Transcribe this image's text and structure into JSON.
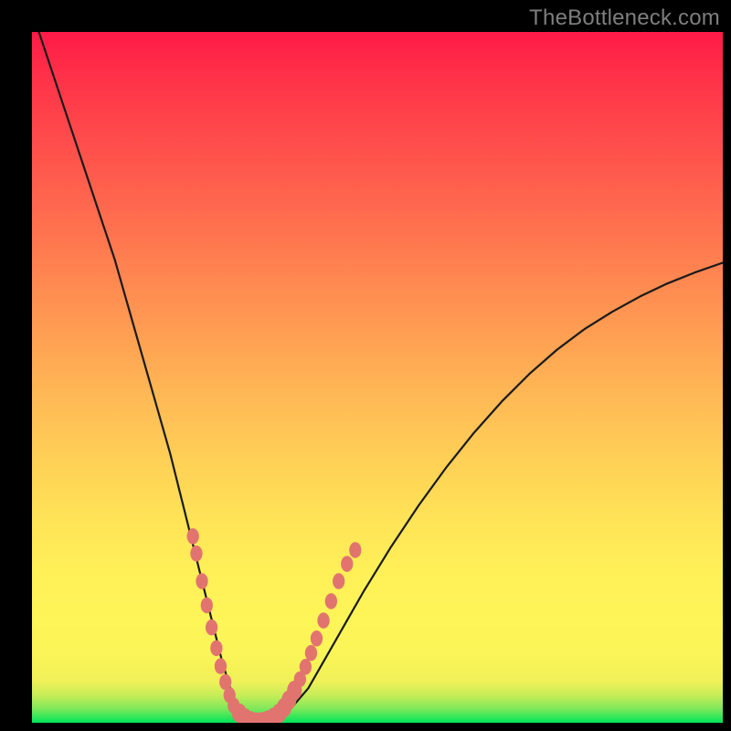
{
  "watermark": "TheBottleneck.com",
  "colors": {
    "frame": "#000000",
    "gradient_top": "#ff1a47",
    "gradient_mid": "#ffe257",
    "gradient_bottom": "#00e55a",
    "curve_stroke": "#1a1a1a",
    "marker_fill": "#e2746f"
  },
  "chart_data": {
    "type": "line",
    "title": "",
    "xlabel": "",
    "ylabel": "",
    "xlim": [
      0,
      100
    ],
    "ylim": [
      0,
      100
    ],
    "curve": {
      "name": "bottleneck-v-curve",
      "x": [
        0,
        2,
        4,
        6,
        8,
        10,
        12,
        14,
        16,
        18,
        20,
        22,
        24,
        26,
        27.5,
        29,
        30.5,
        32,
        33.5,
        35,
        37,
        40,
        44,
        48,
        52,
        56,
        60,
        64,
        68,
        72,
        76,
        80,
        84,
        88,
        92,
        96,
        100
      ],
      "y": [
        103,
        97,
        91,
        85,
        79,
        73,
        67,
        60,
        53,
        46,
        39,
        31,
        23,
        15,
        9,
        4,
        1.5,
        0.3,
        0.1,
        0.4,
        1.5,
        5,
        12,
        19,
        25.5,
        31.5,
        37,
        42,
        46.5,
        50.5,
        54,
        57,
        59.5,
        61.7,
        63.6,
        65.2,
        66.6
      ]
    },
    "markers": {
      "name": "hotspots",
      "x": [
        23.3,
        23.8,
        24.6,
        25.3,
        26.0,
        26.7,
        27.3,
        28.0,
        28.6,
        29.2,
        30.0,
        30.8,
        31.6,
        32.4,
        33.0,
        33.6,
        34.2,
        35.0,
        35.8,
        36.5,
        37.2,
        38.0,
        38.8,
        39.6,
        40.4,
        41.2,
        42.2,
        43.3,
        44.4,
        45.6,
        46.8
      ],
      "y": [
        27.0,
        24.5,
        20.5,
        17.0,
        13.8,
        10.8,
        8.2,
        5.9,
        4.0,
        2.5,
        1.4,
        0.7,
        0.3,
        0.1,
        0.1,
        0.2,
        0.4,
        0.8,
        1.4,
        2.2,
        3.3,
        4.7,
        6.3,
        8.1,
        10.1,
        12.2,
        14.8,
        17.6,
        20.5,
        23.0,
        25.0
      ]
    }
  }
}
